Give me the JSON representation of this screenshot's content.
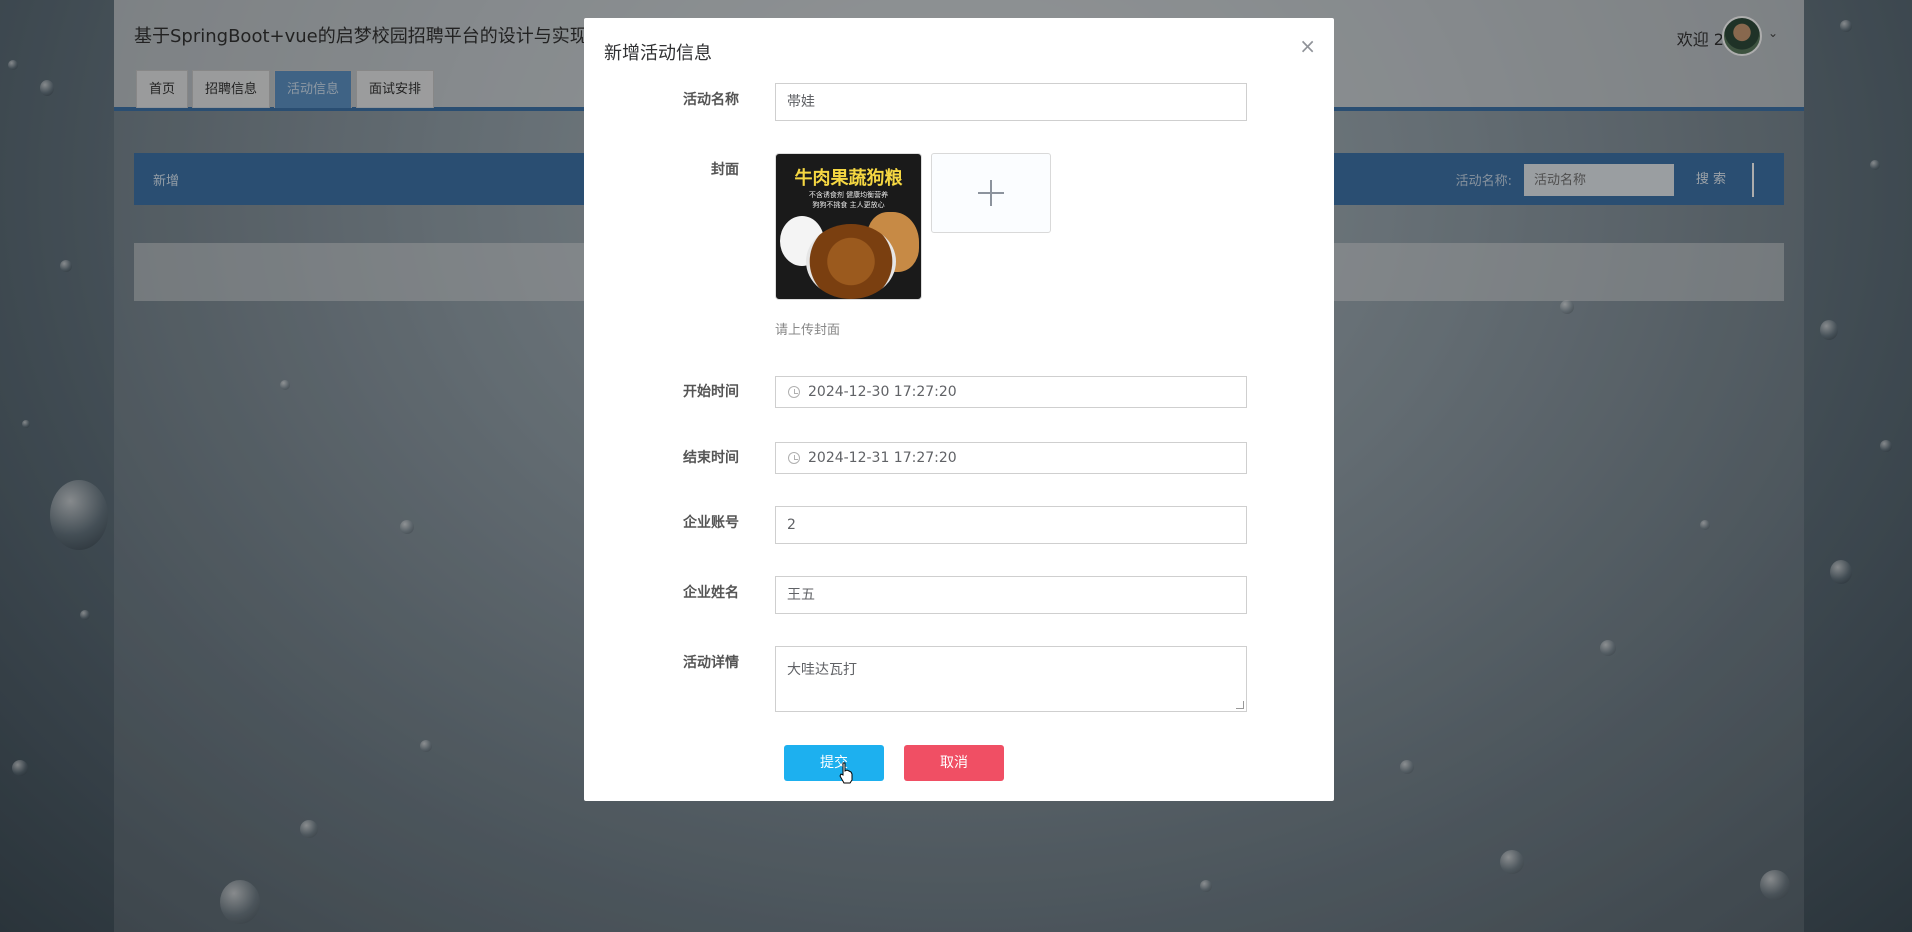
{
  "app": {
    "title": "基于SpringBoot+vue的启梦校园招聘平台的设计与实现",
    "welcome": "欢迎 2",
    "nav": [
      {
        "label": "首页"
      },
      {
        "label": "招聘信息"
      },
      {
        "label": "活动信息"
      },
      {
        "label": "面试安排"
      }
    ],
    "toolbar": {
      "add_label": "新增",
      "search_label": "活动名称:",
      "search_placeholder": "活动名称",
      "search_button": "搜 索"
    }
  },
  "modal": {
    "title": "新增活动信息",
    "fields": {
      "activity_name": {
        "label": "活动名称",
        "value": "帯娃"
      },
      "cover": {
        "label": "封面",
        "tip": "请上传封面",
        "thumb_title": "牛肉果蔬狗粮",
        "thumb_sub": "不含诱食剂 健康均衡营养\n狗狗不挑食 主人更放心"
      },
      "start_time": {
        "label": "开始时间",
        "value": "2024-12-30 17:27:20"
      },
      "end_time": {
        "label": "结束时间",
        "value": "2024-12-31 17:27:20"
      },
      "company_account": {
        "label": "企业账号",
        "value": "2"
      },
      "company_name": {
        "label": "企业姓名",
        "value": "王五"
      },
      "details": {
        "label": "活动详情",
        "value": "大哇达瓦打"
      }
    },
    "submit_label": "提交",
    "cancel_label": "取消"
  }
}
